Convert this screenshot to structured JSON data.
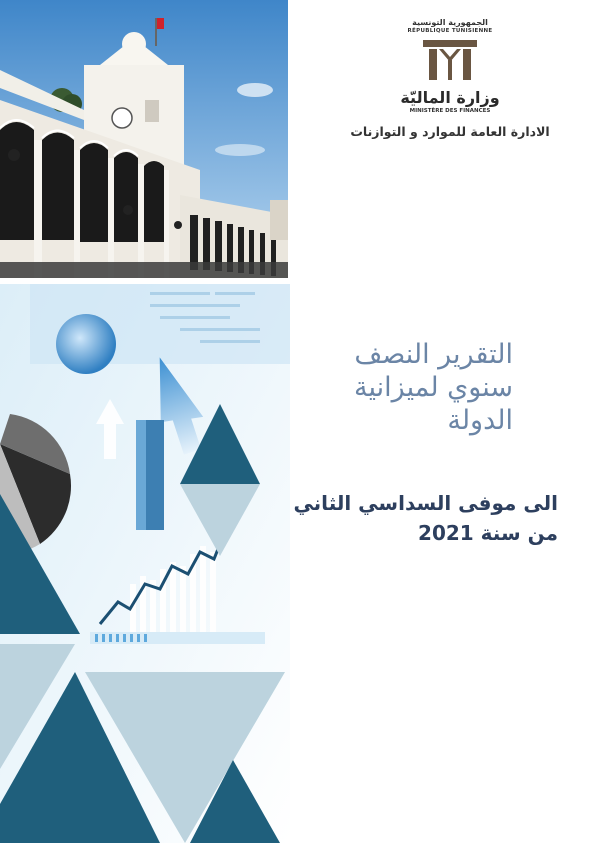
{
  "logo": {
    "republic_ar": "الجمهورية التونسية",
    "republic_fr": "RÉPUBLIQUE TUNISIENNE",
    "ministry_ar": "وزارة الماليّة",
    "ministry_fr": "MINISTÈRE DES FINANCES"
  },
  "department": "الادارة العامة للموارد و التوازنات",
  "title_lines": [
    "التقرير النصف",
    "سنوي لميزانية",
    "الدولة"
  ],
  "subtitle_lines": [
    "الى موفى السداسي الثاني",
    "من سنة 2021"
  ],
  "colors": {
    "brand_dark": "#1f5f7c",
    "brand_mid": "#2f7a99",
    "brand_light": "#bcd3de",
    "title_color": "#6b85a6",
    "subtitle_color": "#2d3f5e"
  },
  "icons": {
    "emblem": "ministry-columns-emblem"
  }
}
